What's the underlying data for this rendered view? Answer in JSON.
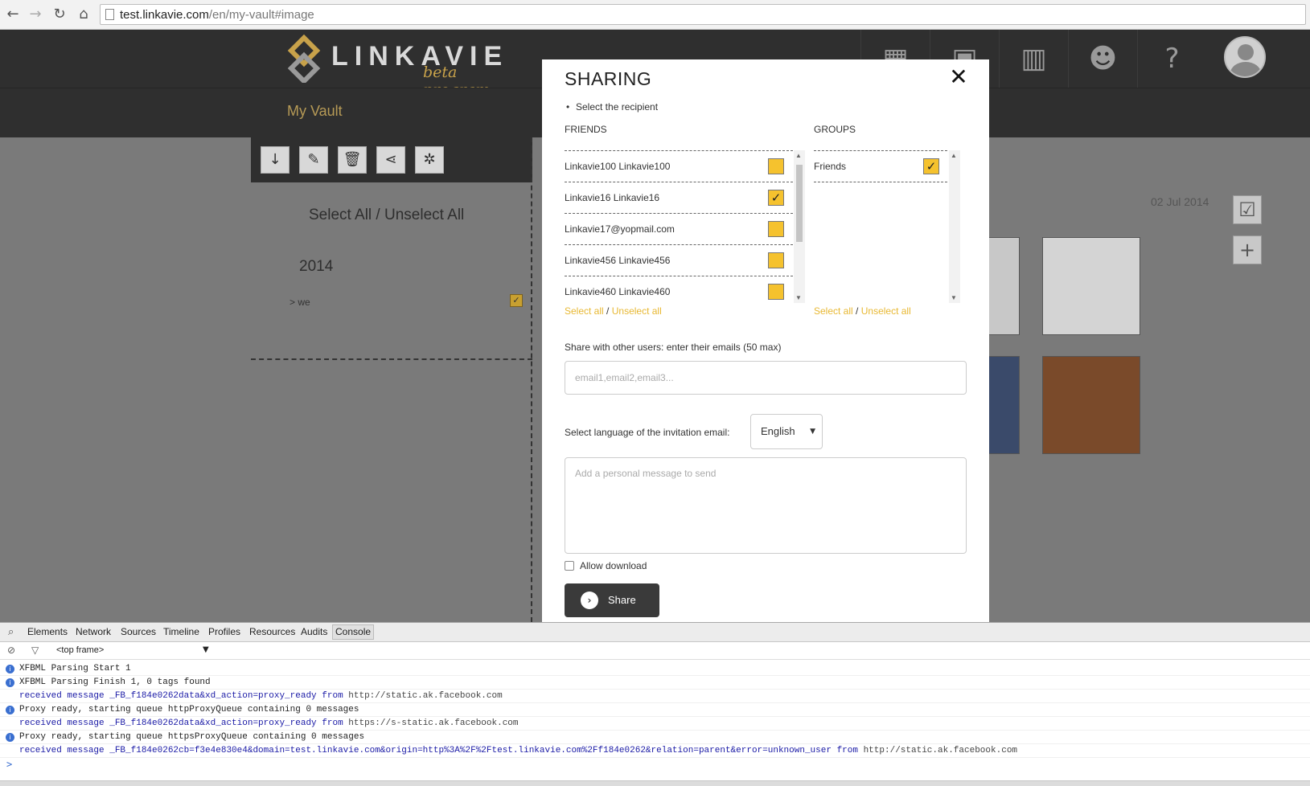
{
  "browser": {
    "url_host": "test.linkavie.com",
    "url_path": "/en/my-vault#image"
  },
  "app": {
    "logo_text": "LINKAVIE",
    "logo_sub": "beta program",
    "section_title": "My Vault",
    "nav_help": "?",
    "select_all": "Select All / Unselect All",
    "year": "2014",
    "album": "> we",
    "date": "02 Jul 2014"
  },
  "modal": {
    "title": "SHARING",
    "instruction": "Select the recipient",
    "friends_header": "FRIENDS",
    "groups_header": "GROUPS",
    "friends": [
      {
        "name": "Linkavie100 Linkavie100",
        "checked": false
      },
      {
        "name": "Linkavie16 Linkavie16",
        "checked": true
      },
      {
        "name": "Linkavie17@yopmail.com",
        "checked": false
      },
      {
        "name": "Linkavie456 Linkavie456",
        "checked": false
      },
      {
        "name": "Linkavie460 Linkavie460",
        "checked": false
      }
    ],
    "groups": [
      {
        "name": "Friends",
        "checked": true
      }
    ],
    "select_all_link": "Select all",
    "link_sep": "/",
    "unselect_all_link": "Unselect all",
    "share_emails_label": "Share with other users: enter their emails (50 max)",
    "emails_placeholder": "email1,email2,email3...",
    "language_label": "Select language of the invitation email:",
    "language_value": "English",
    "message_placeholder": "Add a personal message to send",
    "allow_download": "Allow download",
    "share_button": "Share"
  },
  "devtools": {
    "tabs": [
      "Elements",
      "Network",
      "Sources",
      "Timeline",
      "Profiles",
      "Resources",
      "Audits",
      "Console"
    ],
    "active_tab": "Console",
    "frame": "<top frame>",
    "lines": [
      {
        "type": "info",
        "text": "XFBML Parsing Start 1",
        "src": ""
      },
      {
        "type": "info",
        "text": "XFBML Parsing Finish 1, 0 tags found",
        "src": ""
      },
      {
        "type": "blue",
        "text": "received message _FB_f184e0262data&xd_action=proxy_ready from",
        "src": " http://static.ak.facebook.com"
      },
      {
        "type": "info",
        "text": "Proxy ready, starting queue httpProxyQueue containing 0 messages",
        "src": ""
      },
      {
        "type": "blue",
        "text": "received message _FB_f184e0262data&xd_action=proxy_ready from",
        "src": " https://s-static.ak.facebook.com"
      },
      {
        "type": "info",
        "text": "Proxy ready, starting queue httpsProxyQueue containing 0 messages",
        "src": ""
      },
      {
        "type": "blue",
        "text": "received message _FB_f184e0262cb=f3e4e830e4&domain=test.linkavie.com&origin=http%3A%2F%2Ftest.linkavie.com%2Ff184e0262&relation=parent&error=unknown_user from",
        "src": " http://static.ak.facebook.com"
      }
    ],
    "prompt": ">"
  }
}
